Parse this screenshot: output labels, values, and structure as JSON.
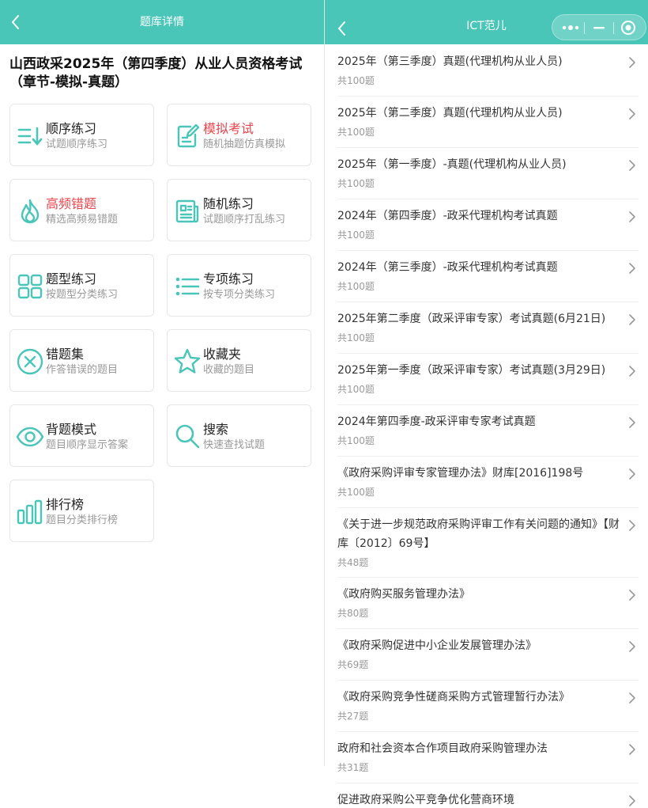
{
  "left": {
    "header_title": "题库详情",
    "exam_title_line1": "山西政采2025年（第四季度）从业人员资格考试",
    "exam_title_line2": "（章节-模拟-真题）",
    "cards": [
      {
        "name": "顺序练习",
        "desc": "试题顺序练习",
        "icon": "sort-icon",
        "accent": false
      },
      {
        "name": "模拟考试",
        "desc": "随机抽题仿真模拟",
        "icon": "edit-paper-icon",
        "accent": true
      },
      {
        "name": "高频错题",
        "desc": "精选高频易错题",
        "icon": "flame-icon",
        "accent": true
      },
      {
        "name": "随机练习",
        "desc": "试题顺序打乱练习",
        "icon": "news-icon",
        "accent": false
      },
      {
        "name": "题型练习",
        "desc": "按题型分类练习",
        "icon": "grid-icon",
        "accent": false
      },
      {
        "name": "专项练习",
        "desc": "按专项分类练习",
        "icon": "list-icon",
        "accent": false
      },
      {
        "name": "错题集",
        "desc": "作答错误的题目",
        "icon": "close-circle-icon",
        "accent": false
      },
      {
        "name": "收藏夹",
        "desc": "收藏的题目",
        "icon": "star-icon",
        "accent": false
      },
      {
        "name": "背题模式",
        "desc": "题目顺序显示答案",
        "icon": "eye-icon",
        "accent": false
      },
      {
        "name": "搜索",
        "desc": "快速查找试题",
        "icon": "search-icon",
        "accent": false
      },
      {
        "name": "排行榜",
        "desc": "题目分类排行榜",
        "icon": "bar-chart-icon",
        "accent": false
      }
    ]
  },
  "right": {
    "header_title": "ICT范儿",
    "items": [
      {
        "title": "2025年（第三季度）真题(代理机构从业人员)",
        "count": "共100题"
      },
      {
        "title": "2025年（第二季度）真题(代理机构从业人员)",
        "count": "共100题"
      },
      {
        "title": "2025年（第一季度）-真题(代理机构从业人员)",
        "count": "共100题"
      },
      {
        "title": "2024年（第四季度）-政采代理机构考试真题",
        "count": "共100题"
      },
      {
        "title": "2024年（第三季度）-政采代理机构考试真题",
        "count": "共100题"
      },
      {
        "title": "2025年第二季度（政采评审专家）考试真题(6月21日)",
        "count": "共100题"
      },
      {
        "title": "2025年第一季度（政采评审专家）考试真题(3月29日)",
        "count": "共100题"
      },
      {
        "title": "2024年第四季度-政采评审专家考试真题",
        "count": "共100题"
      },
      {
        "title": "《政府采购评审专家管理办法》财库[2016]198号",
        "count": "共100题"
      },
      {
        "title": "《关于进一步规范政府采购评审工作有关问题的通知》【财库〔2012〕69号】",
        "count": "共48题"
      },
      {
        "title": "《政府购买服务管理办法》",
        "count": "共80题"
      },
      {
        "title": "《政府采购促进中小企业发展管理办法》",
        "count": "共69题"
      },
      {
        "title": "《政府采购竞争性磋商采购方式管理暂行办法》",
        "count": "共27题"
      },
      {
        "title": "政府和社会资本合作项目政府采购管理办法",
        "count": "共31题"
      },
      {
        "title": "促进政府采购公平竞争优化营商环境",
        "count": ""
      }
    ]
  },
  "colors": {
    "accent": "#4ac6b9",
    "icon": "#4ac6b9",
    "danger": "#e8454d"
  }
}
